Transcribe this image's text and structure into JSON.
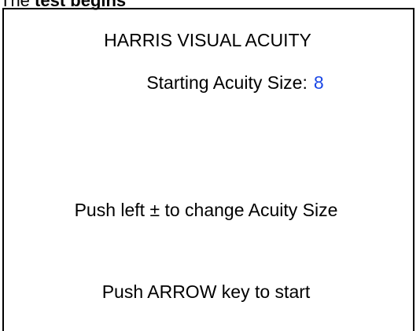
{
  "caption": {
    "prefix": "The ",
    "bold": "test begins"
  },
  "screen": {
    "title": "HARRIS VISUAL ACUITY",
    "acuity_label": "Starting Acuity Size:",
    "acuity_value": "8",
    "instruction_change": "Push left ± to change Acuity Size",
    "instruction_start": "Push ARROW key to start"
  },
  "colors": {
    "value": "#1a47e6",
    "text": "#000000",
    "background": "#ffffff"
  }
}
